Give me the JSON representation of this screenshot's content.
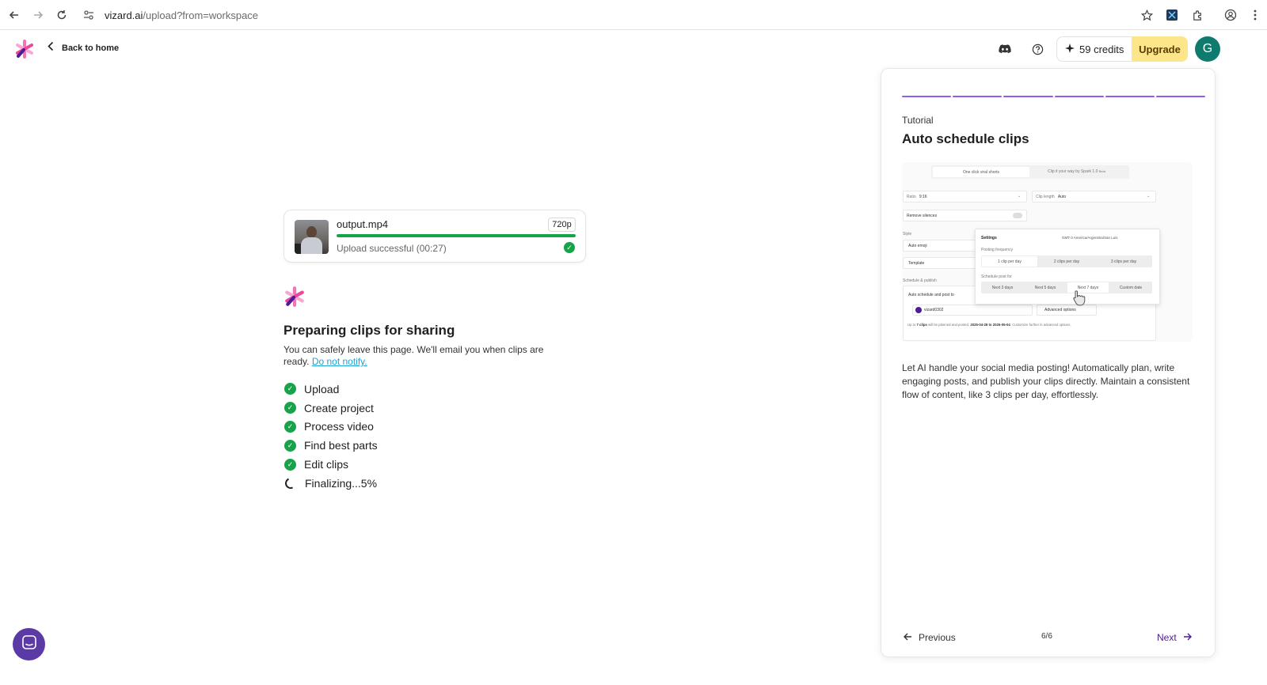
{
  "browser": {
    "url_host": "vizard.ai",
    "url_path": "/upload?from=workspace"
  },
  "header": {
    "back_label": "Back to home",
    "credits_label": "59 credits",
    "upgrade_label": "Upgrade",
    "avatar_initial": "G",
    "brand_colors": {
      "accent": "#8b5cf6",
      "upgrade_bg": "#fde68a",
      "avatar_bg": "#0f7a6e"
    }
  },
  "upload": {
    "file_name": "output.mp4",
    "resolution": "720p",
    "progress": 1.0,
    "status": "Upload successful (00:27)"
  },
  "preparing": {
    "title": "Preparing clips for sharing",
    "description": "You can safely leave this page. We'll email you when clips are ready.",
    "link": "Do not notify."
  },
  "steps": [
    {
      "label": "Upload",
      "state": "done"
    },
    {
      "label": "Create project",
      "state": "done"
    },
    {
      "label": "Process video",
      "state": "done"
    },
    {
      "label": "Find best parts",
      "state": "done"
    },
    {
      "label": "Edit clips",
      "state": "done"
    },
    {
      "label": "Finalizing...5%",
      "state": "in-progress"
    }
  ],
  "tutorial": {
    "kicker": "Tutorial",
    "title": "Auto schedule clips",
    "segments_total": 6,
    "segments_done": 6,
    "text": "Let AI handle your social media posting! Automatically plan, write engaging posts, and publish your clips directly. Maintain a consistent flow of content, like 3 clips per day, effortlessly.",
    "prev_label": "Previous",
    "page_indicator": "6/6",
    "next_label": "Next",
    "preview": {
      "tab1": "One click viral shorts",
      "tab2": "Clip it your way by Spark 1.0",
      "tab2_badge": "Beta",
      "ratio_label": "Ratio",
      "ratio_value": "9:16",
      "cliplen_label": "Clip length",
      "cliplen_value": "Auto",
      "remove_silences": "Remove silences",
      "style_label": "Style",
      "auto_emoji": "Auto emoji",
      "template": "Template",
      "schedule_label": "Schedule & publish",
      "auto_schedule": "Auto schedule and post to",
      "account": "vizard0302",
      "advanced": "Advanced options",
      "footnote_a": "Up to ",
      "footnote_clips": "7 clips",
      "footnote_b": " will be planned and posted, ",
      "footnote_dates": "2025-04-28 to 2025-05-04",
      "footnote_c": ". Customize further in advanced options.",
      "settings_title": "Settings",
      "timezone": "GMT-3 America/Argentina/San Luis",
      "posting_freq": "Posting frequency",
      "freq": [
        "1 clip per day",
        "2 clips per day",
        "3 clips per day"
      ],
      "schedule_for": "Schedule post for",
      "ranges": [
        "Next 3 days",
        "Next 5 days",
        "Next 7 days",
        "Custom date"
      ]
    }
  }
}
